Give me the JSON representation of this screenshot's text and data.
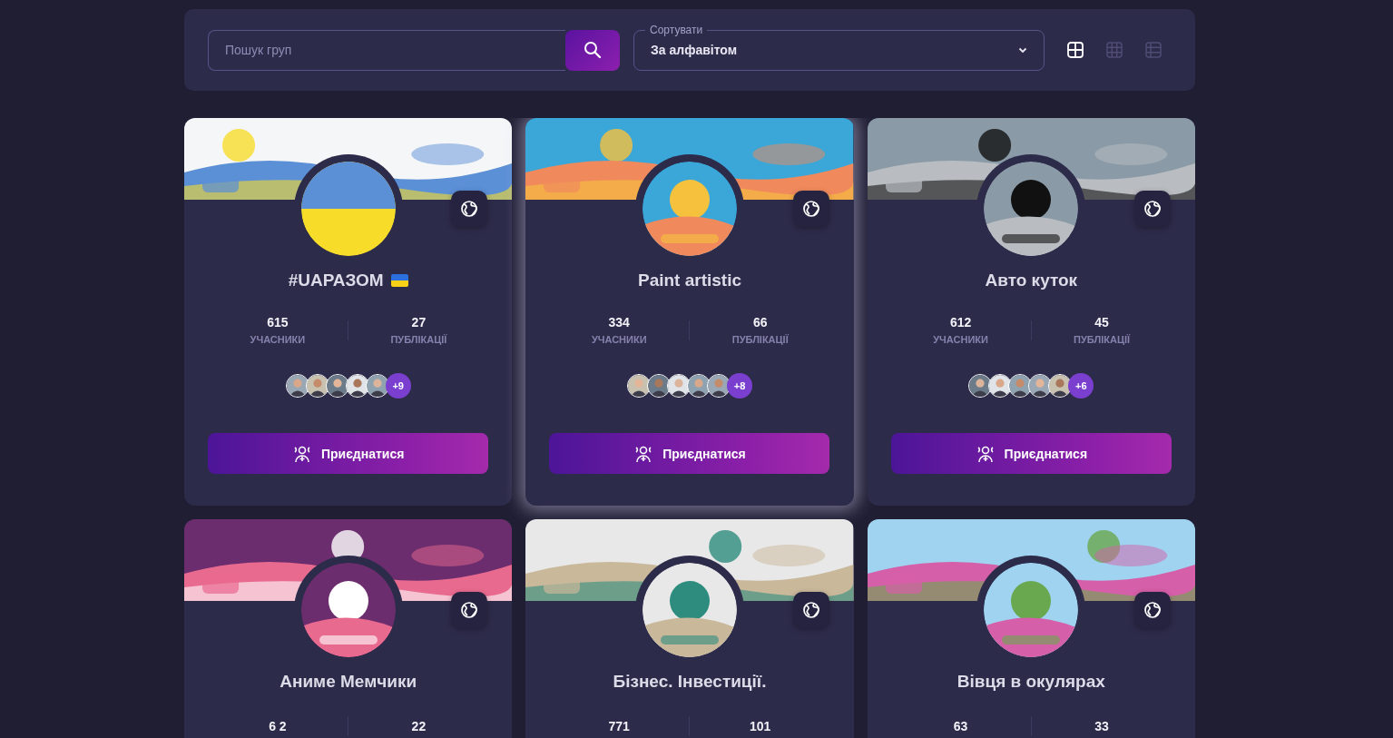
{
  "toolbar": {
    "search": {
      "placeholder": "Пошук груп"
    },
    "sort": {
      "label": "Сортувати",
      "value": "За алфавітом"
    },
    "views": [
      {
        "kind": "large",
        "selected": true
      },
      {
        "kind": "small",
        "selected": false
      },
      {
        "kind": "list",
        "selected": false
      }
    ]
  },
  "groups": [
    {
      "name": "#UAРАЗОМ",
      "flag_icon": true,
      "highlighted": false,
      "stats": [
        {
          "value": "615",
          "label": "УЧАСНИКИ"
        },
        {
          "value": "27",
          "label": "ПУБЛІКАЦІЇ"
        }
      ],
      "member_avatars": [
        {
          "kind": "picture"
        },
        {
          "kind": "picture"
        },
        {
          "kind": "picture"
        },
        {
          "kind": "picture"
        },
        {
          "kind": "picture"
        }
      ],
      "more_members": "+9",
      "button": "Приєднатися"
    },
    {
      "name": "Paint artistic",
      "flag_icon": false,
      "highlighted": true,
      "stats": [
        {
          "value": "334",
          "label": "УЧАСНИКИ"
        },
        {
          "value": "66",
          "label": "ПУБЛІКАЦІЇ"
        }
      ],
      "member_avatars": [
        {
          "kind": "picture"
        },
        {
          "kind": "picture"
        },
        {
          "kind": "picture"
        },
        {
          "kind": "picture"
        },
        {
          "kind": "picture"
        }
      ],
      "more_members": "+8",
      "button": "Приєднатися"
    },
    {
      "name": "Авто куток",
      "flag_icon": false,
      "highlighted": false,
      "stats": [
        {
          "value": "612",
          "label": "УЧАСНИКИ"
        },
        {
          "value": "45",
          "label": "ПУБЛІКАЦІЇ"
        }
      ],
      "member_avatars": [
        {
          "kind": "picture"
        },
        {
          "kind": "picture"
        },
        {
          "kind": "picture"
        },
        {
          "kind": "picture"
        },
        {
          "kind": "picture"
        }
      ],
      "more_members": "+6",
      "button": "Приєднатися"
    },
    {
      "name": "Аниме Мемчики",
      "flag_icon": false,
      "highlighted": false,
      "stats": [
        {
          "value": "6 2"
        },
        {
          "value": "22"
        }
      ]
    },
    {
      "name": "Бізнес. Інвестиції.",
      "flag_icon": false,
      "highlighted": false,
      "stats": [
        {
          "value": "771"
        },
        {
          "value": "101"
        }
      ]
    },
    {
      "name": "Вівця в окулярах",
      "flag_icon": false,
      "highlighted": false,
      "stats": [
        {
          "value": "63"
        },
        {
          "value": "33"
        }
      ]
    }
  ]
}
